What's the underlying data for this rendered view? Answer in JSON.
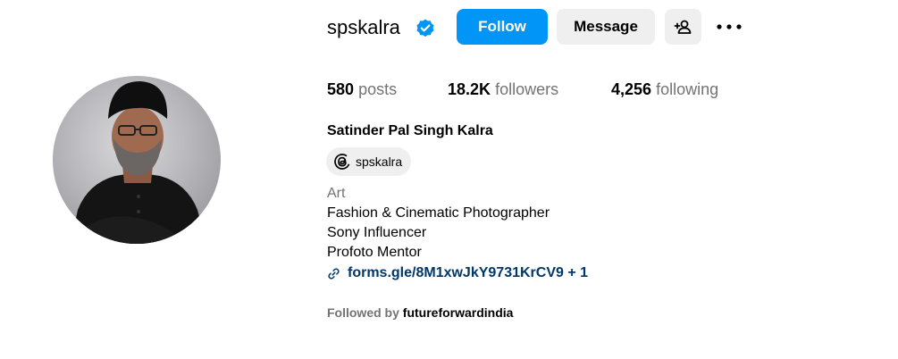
{
  "profile": {
    "username": "spskalra",
    "verified": true,
    "full_name": "Satinder Pal Singh Kalra",
    "category": "Art",
    "bio_lines": [
      "Fashion & Cinematic Photographer",
      "Sony Influencer",
      "Profoto Mentor"
    ],
    "link_text": "forms.gle/8M1xwJkY9731KrCV9 + 1",
    "threads_handle": "spskalra"
  },
  "actions": {
    "follow_label": "Follow",
    "message_label": "Message"
  },
  "stats": {
    "posts_count": "580",
    "posts_label": "posts",
    "followers_count": "18.2K",
    "followers_label": "followers",
    "following_count": "4,256",
    "following_label": "following"
  },
  "followed_by": {
    "prefix": "Followed by",
    "user": "futureforwardindia"
  },
  "icons": {
    "verified": "verified-badge-icon",
    "add_user": "add-user-icon",
    "more": "more-options-icon",
    "threads": "threads-icon",
    "link": "link-icon"
  },
  "colors": {
    "accent_blue": "#0095f6",
    "button_gray": "#efefef",
    "secondary_text": "#737373",
    "link_color": "#00376b"
  }
}
